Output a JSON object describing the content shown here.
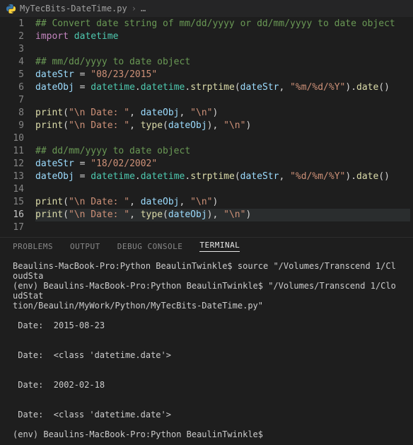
{
  "breadcrumb": {
    "icon": "python-icon",
    "file": "MyTecBits-DateTime.py",
    "more": "…"
  },
  "editor": {
    "currentLine": 16,
    "lines": [
      {
        "n": 1,
        "segs": [
          {
            "c": "c-comment",
            "t": "## Convert date string of mm/dd/yyyy or dd/mm/yyyy to date object"
          }
        ]
      },
      {
        "n": 2,
        "segs": [
          {
            "c": "c-key",
            "t": "import"
          },
          {
            "c": "",
            "t": " "
          },
          {
            "c": "c-mod",
            "t": "datetime"
          }
        ]
      },
      {
        "n": 3,
        "segs": [
          {
            "c": "",
            "t": ""
          }
        ]
      },
      {
        "n": 4,
        "segs": [
          {
            "c": "c-comment",
            "t": "## mm/dd/yyyy to date object"
          }
        ]
      },
      {
        "n": 5,
        "segs": [
          {
            "c": "c-var",
            "t": "dateStr"
          },
          {
            "c": "",
            "t": " = "
          },
          {
            "c": "c-str",
            "t": "\"08/23/2015\""
          }
        ]
      },
      {
        "n": 6,
        "segs": [
          {
            "c": "c-var",
            "t": "dateObj"
          },
          {
            "c": "",
            "t": " = "
          },
          {
            "c": "c-mod",
            "t": "datetime"
          },
          {
            "c": "",
            "t": "."
          },
          {
            "c": "c-mod",
            "t": "datetime"
          },
          {
            "c": "",
            "t": "."
          },
          {
            "c": "c-func",
            "t": "strptime"
          },
          {
            "c": "",
            "t": "("
          },
          {
            "c": "c-var",
            "t": "dateStr"
          },
          {
            "c": "",
            "t": ", "
          },
          {
            "c": "c-str",
            "t": "\"%m/%d/%Y\""
          },
          {
            "c": "",
            "t": ")."
          },
          {
            "c": "c-func",
            "t": "date"
          },
          {
            "c": "",
            "t": "()"
          }
        ]
      },
      {
        "n": 7,
        "segs": [
          {
            "c": "",
            "t": ""
          }
        ]
      },
      {
        "n": 8,
        "segs": [
          {
            "c": "c-func",
            "t": "print"
          },
          {
            "c": "",
            "t": "("
          },
          {
            "c": "c-str",
            "t": "\"\\n Date: \""
          },
          {
            "c": "",
            "t": ", "
          },
          {
            "c": "c-var",
            "t": "dateObj"
          },
          {
            "c": "",
            "t": ", "
          },
          {
            "c": "c-str",
            "t": "\"\\n\""
          },
          {
            "c": "",
            "t": ")"
          }
        ]
      },
      {
        "n": 9,
        "segs": [
          {
            "c": "c-func",
            "t": "print"
          },
          {
            "c": "",
            "t": "("
          },
          {
            "c": "c-str",
            "t": "\"\\n Date: \""
          },
          {
            "c": "",
            "t": ", "
          },
          {
            "c": "c-func",
            "t": "type"
          },
          {
            "c": "",
            "t": "("
          },
          {
            "c": "c-var",
            "t": "dateObj"
          },
          {
            "c": "",
            "t": "), "
          },
          {
            "c": "c-str",
            "t": "\"\\n\""
          },
          {
            "c": "",
            "t": ")"
          }
        ]
      },
      {
        "n": 10,
        "segs": [
          {
            "c": "",
            "t": ""
          }
        ]
      },
      {
        "n": 11,
        "segs": [
          {
            "c": "c-comment",
            "t": "## dd/mm/yyyy to date object"
          }
        ]
      },
      {
        "n": 12,
        "segs": [
          {
            "c": "c-var",
            "t": "dateStr"
          },
          {
            "c": "",
            "t": " = "
          },
          {
            "c": "c-str",
            "t": "\"18/02/2002\""
          }
        ]
      },
      {
        "n": 13,
        "segs": [
          {
            "c": "c-var",
            "t": "dateObj"
          },
          {
            "c": "",
            "t": " = "
          },
          {
            "c": "c-mod",
            "t": "datetime"
          },
          {
            "c": "",
            "t": "."
          },
          {
            "c": "c-mod",
            "t": "datetime"
          },
          {
            "c": "",
            "t": "."
          },
          {
            "c": "c-func",
            "t": "strptime"
          },
          {
            "c": "",
            "t": "("
          },
          {
            "c": "c-var",
            "t": "dateStr"
          },
          {
            "c": "",
            "t": ", "
          },
          {
            "c": "c-str",
            "t": "\"%d/%m/%Y\""
          },
          {
            "c": "",
            "t": ")."
          },
          {
            "c": "c-func",
            "t": "date"
          },
          {
            "c": "",
            "t": "()"
          }
        ]
      },
      {
        "n": 14,
        "segs": [
          {
            "c": "",
            "t": ""
          }
        ]
      },
      {
        "n": 15,
        "segs": [
          {
            "c": "c-func",
            "t": "print"
          },
          {
            "c": "",
            "t": "("
          },
          {
            "c": "c-str",
            "t": "\"\\n Date: \""
          },
          {
            "c": "",
            "t": ", "
          },
          {
            "c": "c-var",
            "t": "dateObj"
          },
          {
            "c": "",
            "t": ", "
          },
          {
            "c": "c-str",
            "t": "\"\\n\""
          },
          {
            "c": "",
            "t": ")"
          }
        ]
      },
      {
        "n": 16,
        "segs": [
          {
            "c": "c-func",
            "t": "print"
          },
          {
            "c": "",
            "t": "("
          },
          {
            "c": "c-str",
            "t": "\"\\n Date: \""
          },
          {
            "c": "",
            "t": ", "
          },
          {
            "c": "c-func",
            "t": "type"
          },
          {
            "c": "",
            "t": "("
          },
          {
            "c": "c-var",
            "t": "dateObj"
          },
          {
            "c": "",
            "t": "), "
          },
          {
            "c": "c-str",
            "t": "\"\\n\""
          },
          {
            "c": "",
            "t": ")"
          }
        ]
      },
      {
        "n": 17,
        "segs": [
          {
            "c": "",
            "t": ""
          }
        ]
      }
    ]
  },
  "panel": {
    "tabs": {
      "problems": "PROBLEMS",
      "output": "OUTPUT",
      "debug": "DEBUG CONSOLE",
      "terminal": "TERMINAL"
    },
    "active": "TERMINAL"
  },
  "terminal": {
    "text": "Beaulins-MacBook-Pro:Python BeaulinTwinkle$ source \"/Volumes/Transcend 1/CloudSta\n(env) Beaulins-MacBook-Pro:Python BeaulinTwinkle$ \"/Volumes/Transcend 1/CloudStat\ntion/Beaulin/MyWork/Python/MyTecBits-DateTime.py\"\n\n Date:  2015-08-23 \n\n\n Date:  <class 'datetime.date'> \n\n\n Date:  2002-02-18 \n\n\n Date:  <class 'datetime.date'> \n\n(env) Beaulins-MacBook-Pro:Python BeaulinTwinkle$ "
  }
}
